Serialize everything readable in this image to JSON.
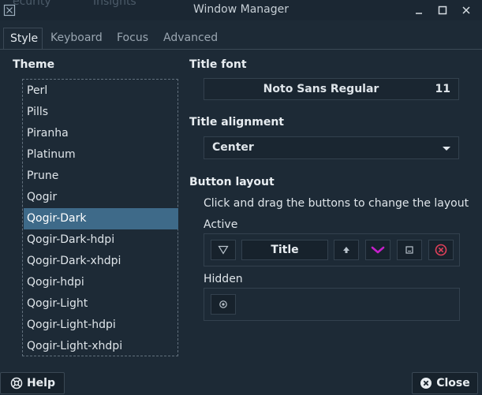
{
  "window": {
    "title": "Window Manager",
    "behind_tabs": [
      "ecurity",
      "Insights"
    ]
  },
  "tabs": [
    {
      "label": "Style",
      "active": true
    },
    {
      "label": "Keyboard",
      "active": false
    },
    {
      "label": "Focus",
      "active": false
    },
    {
      "label": "Advanced",
      "active": false
    }
  ],
  "theme": {
    "heading": "Theme",
    "items": [
      "Perl",
      "Pills",
      "Piranha",
      "Platinum",
      "Prune",
      "Qogir",
      "Qogir-Dark",
      "Qogir-Dark-hdpi",
      "Qogir-Dark-xhdpi",
      "Qogir-hdpi",
      "Qogir-Light",
      "Qogir-Light-hdpi",
      "Qogir-Light-xhdpi"
    ],
    "selected": "Qogir-Dark"
  },
  "title_font": {
    "heading": "Title font",
    "font_name": "Noto Sans Regular",
    "font_size": "11"
  },
  "title_alignment": {
    "heading": "Title alignment",
    "value": "Center"
  },
  "button_layout": {
    "heading": "Button layout",
    "description": "Click and drag the buttons to change the layout",
    "active_label": "Active",
    "title_button": "Title",
    "hidden_label": "Hidden"
  },
  "footer": {
    "help_label": "Help",
    "close_label": "Close"
  },
  "colors": {
    "background": "#1d2a36",
    "selection": "#3e6a89",
    "shade_accent": "#c41fc9",
    "close_accent": "#e0405a"
  }
}
